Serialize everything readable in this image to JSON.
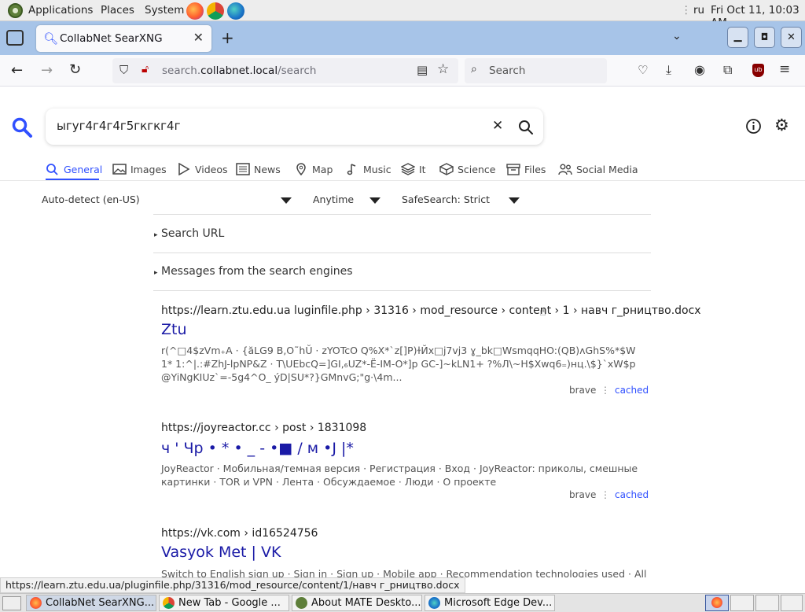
{
  "system_panel": {
    "menus": [
      "Applications",
      "Places",
      "System"
    ],
    "keyboard_layout": "ru",
    "clock": "Fri Oct 11, 10:03 AM"
  },
  "browser": {
    "tab_title": "CollabNet SearXNG",
    "url_prefix": "search.",
    "url_domain": "collabnet.local",
    "url_path": "/search",
    "search_placeholder": "Search"
  },
  "searx": {
    "query": "ыгуг4г4г4г5гкгкг4г",
    "categories": [
      "General",
      "Images",
      "Videos",
      "News",
      "Map",
      "Music",
      "It",
      "Science",
      "Files",
      "Social Media"
    ],
    "active_category": "General",
    "filters": {
      "language": "Auto-detect (en-US)",
      "time": "Anytime",
      "safesearch": "SafeSearch: Strict"
    },
    "search_url_label": "Search URL",
    "messages_label": "Messages from the search engines"
  },
  "results": [
    {
      "url": "https://learn.ztu.edu.ua  luginfile.php › 31316 › mod_resource › content › 1 › навч г_рництво.docx",
      "title": "Ztu",
      "content": "r(^□4$zVm₊А · {ăLG9 B,O˜hŬ · zYOTcO Q%X*`z[]P)ɫЙx□j7vj3 ɣ_bk□WsmqqHO:(QB)ʌGhS%*$W 1* 1:^|.:#ZhJ-lpNP&Z · T\\UEbcQ=]GI,₆UZ*-Ё-IM-O*]p GC-]~kLN1+ ?%Л\\~H$Xwq6₌)нц.\\$}`xW$p @YiNgKIUz`=-5g4^O_ ýD|SU*?}GMnvG;\"g·\\4m...",
      "engine": "brave",
      "cached": "cached"
    },
    {
      "url": "https://joyreactor.cc  › post › 1831098",
      "title": "ч ' Чр • * • _ - •■ / м •J |*",
      "content": "JoyReactor · Мобильная/темная версия · Регистрация · Вход · JoyReactor: приколы, смешные картинки · TOR и VPN · Лента · Обсуждаемое · Люди · О проекте",
      "engine": "brave",
      "cached": "cached"
    },
    {
      "url": "https://vk.com  › id16524756",
      "title": "Vasyok Met | VK",
      "content": "Switch to English sign up · Sign in · Sign up · Mobile app · Recommendation technologies used · All posts ·",
      "engine": "",
      "cached": ""
    }
  ],
  "status_url": "https://learn.ztu.edu.ua/pluginfile.php/31316/mod_resource/content/1/навч г_рництво.docx",
  "taskbar": {
    "tasks": [
      "CollabNet SearXNG...",
      "New Tab - Google ...",
      "About MATE Deskto...",
      "Microsoft Edge Dev..."
    ]
  }
}
